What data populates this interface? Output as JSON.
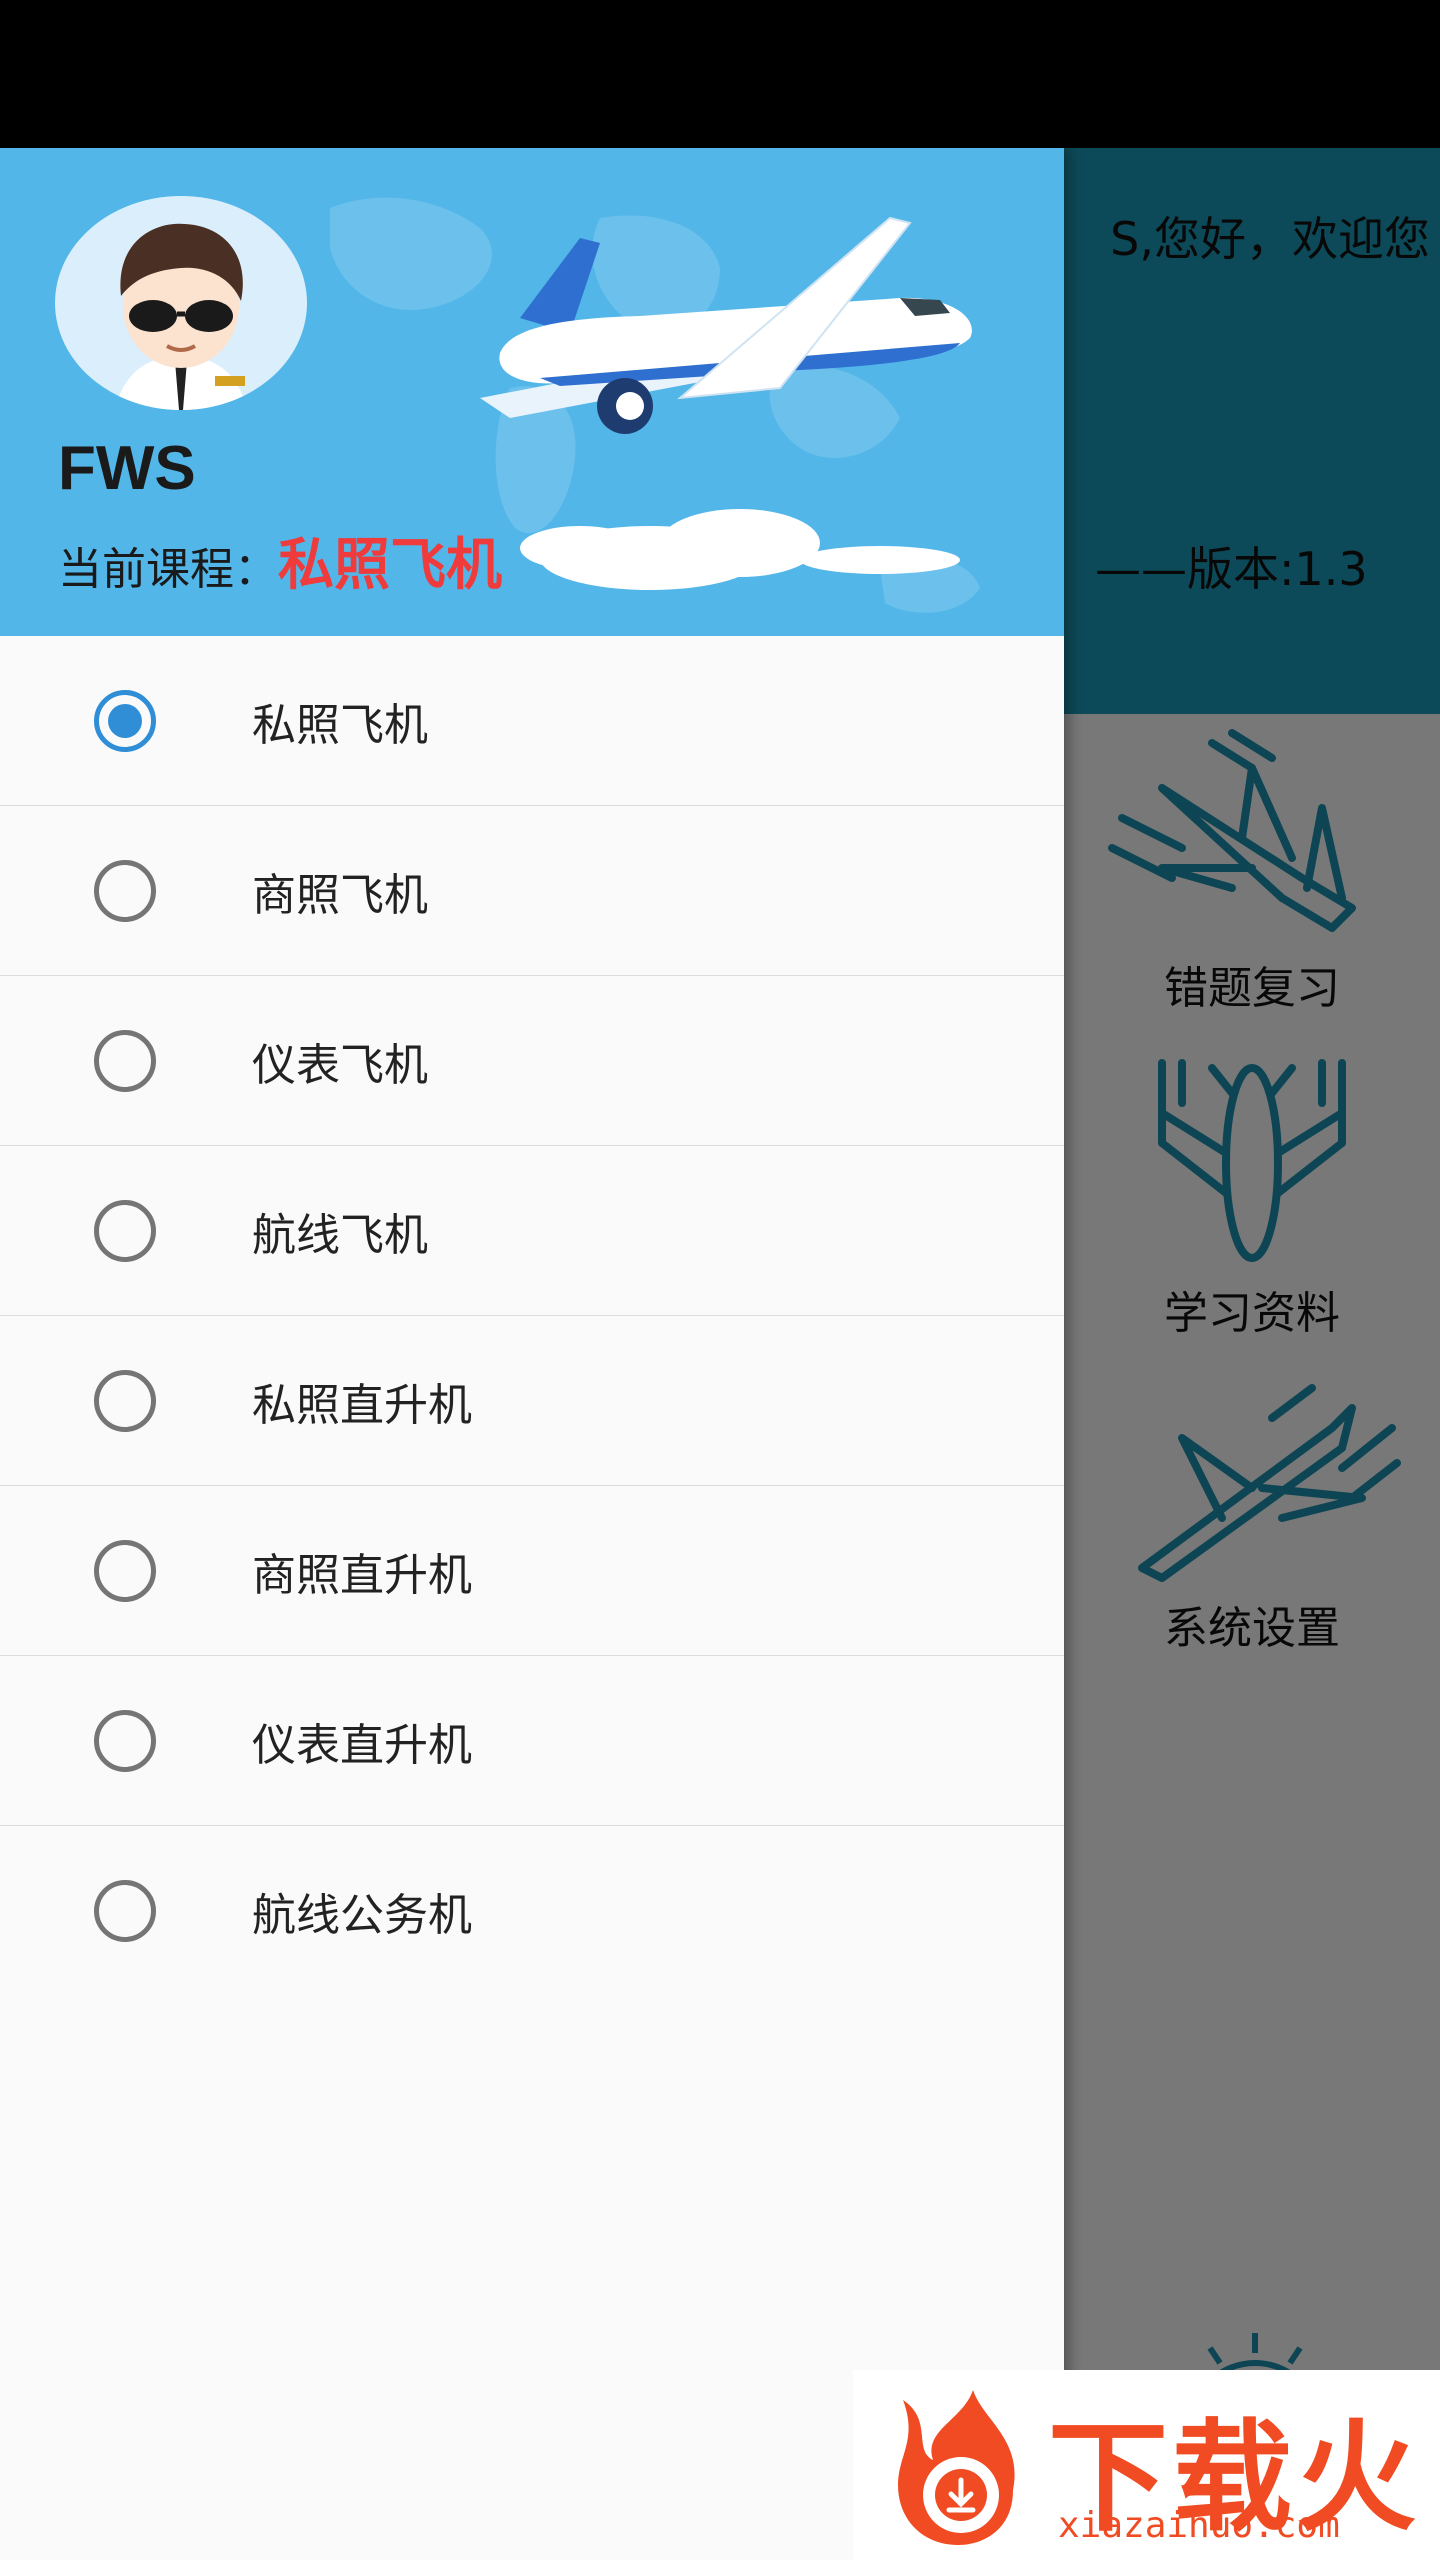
{
  "background": {
    "greeting": "S,您好，欢迎您",
    "version": "——版本:1.3",
    "menu": [
      {
        "label": "错题复习",
        "icon": "plane-dive-icon"
      },
      {
        "label": "学习资料",
        "icon": "plane-down-icon"
      },
      {
        "label": "系统设置",
        "icon": "plane-climb-icon"
      }
    ]
  },
  "drawer": {
    "user_name": "FWS",
    "course_label": "当前课程：",
    "current_course": "私照飞机",
    "courses": [
      {
        "label": "私照飞机",
        "selected": true
      },
      {
        "label": "商照飞机",
        "selected": false
      },
      {
        "label": "仪表飞机",
        "selected": false
      },
      {
        "label": "航线飞机",
        "selected": false
      },
      {
        "label": "私照直升机",
        "selected": false
      },
      {
        "label": "商照直升机",
        "selected": false
      },
      {
        "label": "仪表直升机",
        "selected": false
      },
      {
        "label": "航线公务机",
        "selected": false
      }
    ]
  },
  "watermark": {
    "text": "下载火",
    "url": "xiazaihuo.com"
  },
  "colors": {
    "header_blue": "#52b6e9",
    "app_teal": "#1b95b3",
    "accent_red": "#ef3b3b",
    "radio_blue": "#2f8ed6"
  }
}
